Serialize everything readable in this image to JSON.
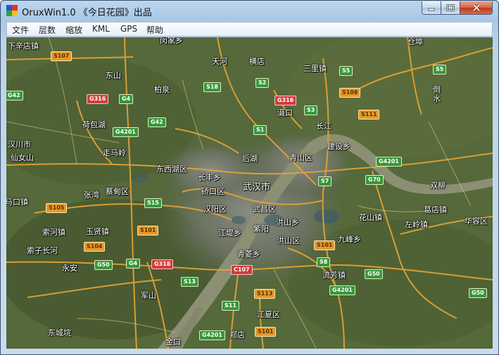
{
  "window": {
    "title": "OruxWin1.0 《今日花园》出品",
    "controls": [
      "minimize",
      "maximize",
      "close"
    ]
  },
  "menu": [
    "文件",
    "层数",
    "缩放",
    "KML",
    "GPS",
    "帮助"
  ],
  "map": {
    "place_labels": [
      "下辛店镇",
      "闵家乡",
      "天河",
      "横店",
      "仓埠",
      "东山",
      "柏泉",
      "三里镇",
      "倒水",
      "汉川市",
      "仙女山",
      "走马岭",
      "荷包湖",
      "东西湖区",
      "后湖",
      "青山区",
      "建设乡",
      "双柳",
      "滠口",
      "长江",
      "长丰乡",
      "武汉市",
      "马口镇",
      "张湾",
      "蔡甸区",
      "硚口区",
      "汉阳区",
      "武昌区",
      "葛店镇",
      "洪山乡",
      "花山镇",
      "左岭镇",
      "华容区",
      "索河镇",
      "玉贤镇",
      "江堤乡",
      "紫阳",
      "洪山区",
      "九峰乡",
      "索子长河",
      "永安",
      "青菱乡",
      "流芳镇",
      "军山",
      "江夏区",
      "东城垸",
      "郑店",
      "金口"
    ],
    "road_shields": [
      {
        "label": "S107",
        "type": "s"
      },
      {
        "label": "S5",
        "type": "g"
      },
      {
        "label": "S5",
        "type": "g"
      },
      {
        "label": "S18",
        "type": "g"
      },
      {
        "label": "S2",
        "type": "g"
      },
      {
        "label": "G316",
        "type": "r"
      },
      {
        "label": "G4",
        "type": "g"
      },
      {
        "label": "G316",
        "type": "r"
      },
      {
        "label": "S3",
        "type": "g"
      },
      {
        "label": "S108",
        "type": "s"
      },
      {
        "label": "S111",
        "type": "s"
      },
      {
        "label": "G42",
        "type": "g"
      },
      {
        "label": "S1",
        "type": "g"
      },
      {
        "label": "G4201",
        "type": "g"
      },
      {
        "label": "G4201",
        "type": "g"
      },
      {
        "label": "S7",
        "type": "g"
      },
      {
        "label": "G70",
        "type": "g"
      },
      {
        "label": "S15",
        "type": "g"
      },
      {
        "label": "S105",
        "type": "s"
      },
      {
        "label": "S101",
        "type": "s"
      },
      {
        "label": "S104",
        "type": "s"
      },
      {
        "label": "S101",
        "type": "s"
      },
      {
        "label": "G50",
        "type": "g"
      },
      {
        "label": "G4",
        "type": "g"
      },
      {
        "label": "G318",
        "type": "r"
      },
      {
        "label": "S8",
        "type": "g"
      },
      {
        "label": "C107",
        "type": "r"
      },
      {
        "label": "G50",
        "type": "g"
      },
      {
        "label": "S13",
        "type": "g"
      },
      {
        "label": "S11",
        "type": "g"
      },
      {
        "label": "G4201",
        "type": "g"
      },
      {
        "label": "S113",
        "type": "s"
      },
      {
        "label": "G4201",
        "type": "g"
      },
      {
        "label": "S101",
        "type": "s"
      },
      {
        "label": "G50",
        "type": "g"
      },
      {
        "label": "G42",
        "type": "g"
      }
    ]
  },
  "colors": {
    "highway": "#39963a",
    "provincial": "#e29a2a",
    "national": "#d23c3c",
    "river": "#8c8f74"
  }
}
